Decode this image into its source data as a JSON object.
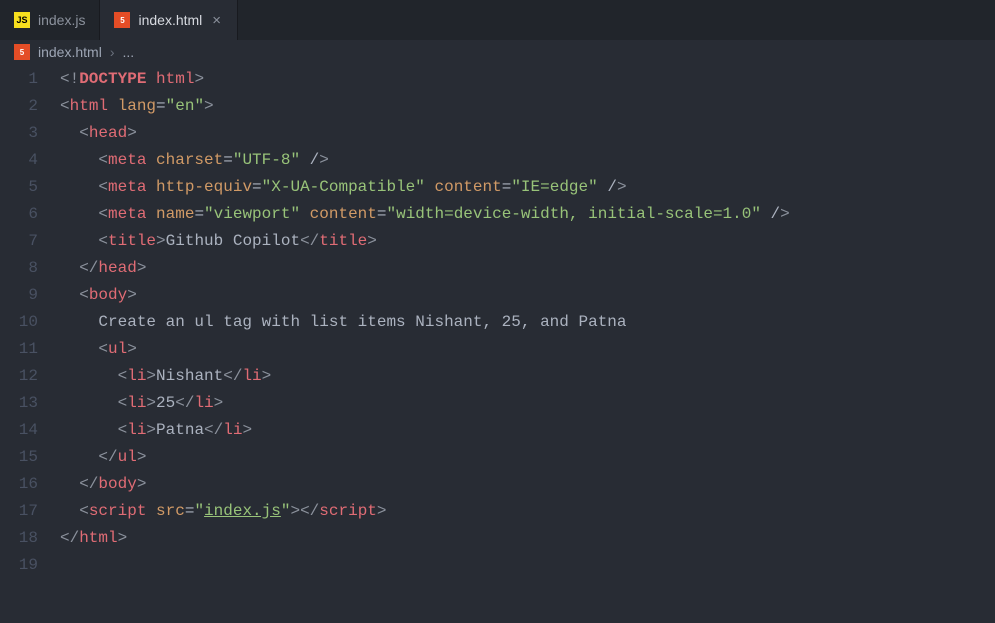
{
  "tabs": [
    {
      "icon": "js",
      "label": "index.js",
      "active": false,
      "closable": false,
      "icon_text": "JS"
    },
    {
      "icon": "html",
      "label": "index.html",
      "active": true,
      "closable": true,
      "icon_text": "5"
    }
  ],
  "breadcrumb": {
    "icon": "html",
    "icon_text": "5",
    "file": "index.html",
    "separator": "›",
    "rest": "..."
  },
  "close_glyph": "×",
  "code": {
    "lines": [
      {
        "n": "1",
        "indent": 0,
        "tokens": [
          [
            "pu",
            "<!"
          ],
          [
            "dt",
            "DOCTYPE"
          ],
          [
            "t",
            " html"
          ],
          [
            "pu",
            ">"
          ]
        ]
      },
      {
        "n": "2",
        "indent": 0,
        "tokens": [
          [
            "pu",
            "<"
          ],
          [
            "t",
            "html"
          ],
          [
            "a",
            " lang"
          ],
          [
            "p",
            "="
          ],
          [
            "s",
            "\"en\""
          ],
          [
            "pu",
            ">"
          ]
        ]
      },
      {
        "n": "3",
        "indent": 1,
        "tokens": [
          [
            "pu",
            "<"
          ],
          [
            "t",
            "head"
          ],
          [
            "pu",
            ">"
          ]
        ]
      },
      {
        "n": "4",
        "indent": 2,
        "tokens": [
          [
            "pu",
            "<"
          ],
          [
            "t",
            "meta"
          ],
          [
            "a",
            " charset"
          ],
          [
            "p",
            "="
          ],
          [
            "s",
            "\"UTF-8\""
          ],
          [
            "p",
            " /"
          ],
          [
            "pu",
            ">"
          ]
        ]
      },
      {
        "n": "5",
        "indent": 2,
        "tokens": [
          [
            "pu",
            "<"
          ],
          [
            "t",
            "meta"
          ],
          [
            "a",
            " http-equiv"
          ],
          [
            "p",
            "="
          ],
          [
            "s",
            "\"X-UA-Compatible\""
          ],
          [
            "a",
            " content"
          ],
          [
            "p",
            "="
          ],
          [
            "s",
            "\"IE=edge\""
          ],
          [
            "p",
            " /"
          ],
          [
            "pu",
            ">"
          ]
        ]
      },
      {
        "n": "6",
        "indent": 2,
        "tokens": [
          [
            "pu",
            "<"
          ],
          [
            "t",
            "meta"
          ],
          [
            "a",
            " name"
          ],
          [
            "p",
            "="
          ],
          [
            "s",
            "\"viewport\""
          ],
          [
            "a",
            " content"
          ],
          [
            "p",
            "="
          ],
          [
            "s",
            "\"width=device-width, initial-scale=1.0\""
          ],
          [
            "p",
            " /"
          ],
          [
            "pu",
            ">"
          ]
        ]
      },
      {
        "n": "7",
        "indent": 2,
        "tokens": [
          [
            "pu",
            "<"
          ],
          [
            "t",
            "title"
          ],
          [
            "pu",
            ">"
          ],
          [
            "tx",
            "Github Copilot"
          ],
          [
            "pu",
            "</"
          ],
          [
            "t",
            "title"
          ],
          [
            "pu",
            ">"
          ]
        ]
      },
      {
        "n": "8",
        "indent": 1,
        "tokens": [
          [
            "pu",
            "</"
          ],
          [
            "t",
            "head"
          ],
          [
            "pu",
            ">"
          ]
        ]
      },
      {
        "n": "9",
        "indent": 1,
        "tokens": [
          [
            "pu",
            "<"
          ],
          [
            "t",
            "body"
          ],
          [
            "pu",
            ">"
          ]
        ]
      },
      {
        "n": "10",
        "indent": 2,
        "tokens": [
          [
            "tx",
            "Create an ul tag with list items Nishant, 25, and Patna"
          ]
        ]
      },
      {
        "n": "11",
        "indent": 2,
        "tokens": [
          [
            "pu",
            "<"
          ],
          [
            "t",
            "ul"
          ],
          [
            "pu",
            ">"
          ]
        ]
      },
      {
        "n": "12",
        "indent": 3,
        "tokens": [
          [
            "pu",
            "<"
          ],
          [
            "t",
            "li"
          ],
          [
            "pu",
            ">"
          ],
          [
            "tx",
            "Nishant"
          ],
          [
            "pu",
            "</"
          ],
          [
            "t",
            "li"
          ],
          [
            "pu",
            ">"
          ]
        ]
      },
      {
        "n": "13",
        "indent": 3,
        "tokens": [
          [
            "pu",
            "<"
          ],
          [
            "t",
            "li"
          ],
          [
            "pu",
            ">"
          ],
          [
            "tx",
            "25"
          ],
          [
            "pu",
            "</"
          ],
          [
            "t",
            "li"
          ],
          [
            "pu",
            ">"
          ]
        ]
      },
      {
        "n": "14",
        "indent": 3,
        "tokens": [
          [
            "pu",
            "<"
          ],
          [
            "t",
            "li"
          ],
          [
            "pu",
            ">"
          ],
          [
            "tx",
            "Patna"
          ],
          [
            "pu",
            "</"
          ],
          [
            "t",
            "li"
          ],
          [
            "pu",
            ">"
          ]
        ]
      },
      {
        "n": "15",
        "indent": 2,
        "tokens": [
          [
            "pu",
            "</"
          ],
          [
            "t",
            "ul"
          ],
          [
            "pu",
            ">"
          ]
        ]
      },
      {
        "n": "16",
        "indent": 1,
        "tokens": [
          [
            "pu",
            "</"
          ],
          [
            "t",
            "body"
          ],
          [
            "pu",
            ">"
          ]
        ]
      },
      {
        "n": "17",
        "indent": 1,
        "tokens": [
          [
            "pu",
            "<"
          ],
          [
            "t",
            "script"
          ],
          [
            "a",
            " src"
          ],
          [
            "p",
            "="
          ],
          [
            "s",
            "\""
          ],
          [
            "su",
            "index.js"
          ],
          [
            "s",
            "\""
          ],
          [
            "pu",
            ">"
          ],
          [
            "pu",
            "</"
          ],
          [
            "t",
            "script"
          ],
          [
            "pu",
            ">"
          ]
        ]
      },
      {
        "n": "18",
        "indent": 0,
        "tokens": [
          [
            "pu",
            "</"
          ],
          [
            "t",
            "html"
          ],
          [
            "pu",
            ">"
          ]
        ]
      },
      {
        "n": "19",
        "indent": 0,
        "tokens": []
      }
    ]
  }
}
